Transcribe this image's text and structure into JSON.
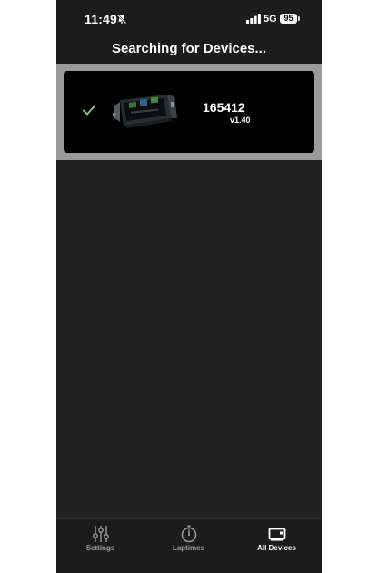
{
  "status_bar": {
    "time": "11:49",
    "network": "5G",
    "battery": "95"
  },
  "header": {
    "title": "Searching for Devices..."
  },
  "devices": [
    {
      "serial": "165412",
      "version": "v1.40",
      "connected": true
    }
  ],
  "tabs": [
    {
      "label": "Settings",
      "icon": "sliders-icon",
      "active": false
    },
    {
      "label": "Laptimes",
      "icon": "stopwatch-icon",
      "active": false
    },
    {
      "label": "All Devices",
      "icon": "device-icon",
      "active": true
    }
  ],
  "colors": {
    "background": "#222222",
    "bars": "#1c1c1c",
    "list_background": "#9a9a9c",
    "card": "#000000",
    "check": "#7fc27a",
    "inactive_tab": "#9c9c9c"
  }
}
